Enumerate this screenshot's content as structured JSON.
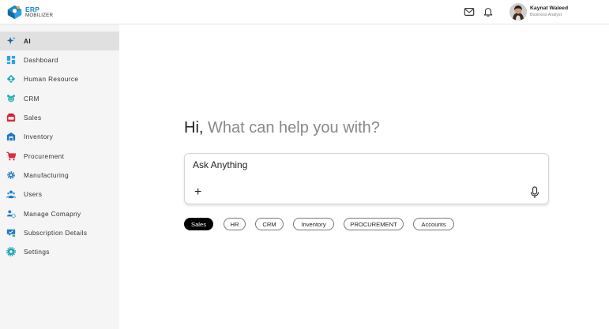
{
  "app": {
    "logo_title": "ERP",
    "logo_subtitle": "MOBILIZER",
    "brand_color": "#1e88c9"
  },
  "header": {
    "icons": [
      "mail-icon",
      "bell-icon"
    ],
    "user": {
      "name": "Kaynat Waleed",
      "role": "Business Analyst"
    }
  },
  "sidebar": {
    "items": [
      {
        "label": "AI",
        "icon": "ai-sparkle-icon",
        "active": true
      },
      {
        "label": "Dashboard",
        "icon": "dashboard-icon"
      },
      {
        "label": "Human Resource",
        "icon": "human-resource-icon"
      },
      {
        "label": "CRM",
        "icon": "crm-icon"
      },
      {
        "label": "Sales",
        "icon": "sales-icon"
      },
      {
        "label": "Inventory",
        "icon": "inventory-icon"
      },
      {
        "label": "Procurement",
        "icon": "procurement-cart-icon"
      },
      {
        "label": "Manufacturing",
        "icon": "manufacturing-gear-icon"
      },
      {
        "label": "Users",
        "icon": "users-icon"
      },
      {
        "label": "Manage Comapny",
        "icon": "manage-company-icon"
      },
      {
        "label": "Subscription Details",
        "icon": "subscription-icon"
      },
      {
        "label": "Settings",
        "icon": "settings-gear-icon"
      }
    ]
  },
  "main": {
    "greeting_hi": "Hi,",
    "greeting_rest": " What can help you with?",
    "ask": {
      "placeholder": "Ask Anything",
      "add_label": "+"
    },
    "chips": [
      {
        "label": "Sales",
        "active": true
      },
      {
        "label": "HR"
      },
      {
        "label": "CRM"
      },
      {
        "label": "Inventory"
      },
      {
        "label": "PROCUREMENT"
      },
      {
        "label": "Accounts"
      }
    ]
  }
}
